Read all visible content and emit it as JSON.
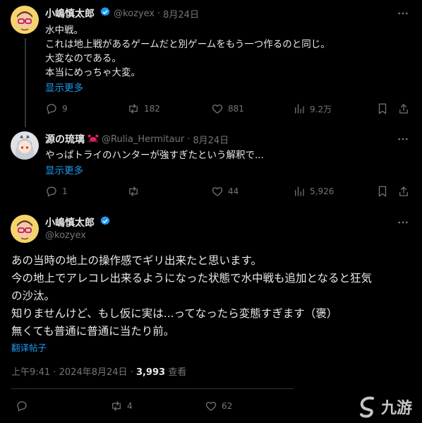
{
  "tweet1": {
    "author": "小嶋慎太郎",
    "handle": "@kozyex",
    "sep": "·",
    "date": "8月24日",
    "lines": [
      "水中戦。",
      "これは地上戦があるゲームだと別ゲームをもう一つ作るのと同じ。",
      "大変なのである。",
      "本当にめっちゃ大変。"
    ],
    "show_more": "显示更多",
    "replies": "9",
    "retweets": "182",
    "likes": "881",
    "views": "9.2万"
  },
  "tweet2": {
    "author": "源の琉璃",
    "handle": "@Rulia_Hermitaur",
    "sep": "·",
    "date": "8月24日",
    "lines": [
      "やっぱトライのハンターが強すぎたという解釈で..."
    ],
    "show_more": "显示更多",
    "replies": "1",
    "likes": "44",
    "views": "5,926"
  },
  "main_tweet": {
    "author": "小嶋慎太郎",
    "handle": "@kozyex",
    "lines": [
      "あの当時の地上の操作感でギリ出来たと思います。",
      "今の地上でアレコレ出来るようになった状態で水中戦も追加となると狂気",
      "の沙汰。",
      "知りませんけど、もし仮に実は...ってなったら変態すぎます（褒）",
      "無くても普通に普通に当たり前。"
    ],
    "translate": "翻译帖子",
    "time": "上午9:41",
    "date": "2024年8月24日",
    "view_count": "3,993",
    "view_label": "查看",
    "retweets": "4",
    "likes": "62"
  },
  "watermark": {
    "text": "九游"
  },
  "colors": {
    "accent": "#1d9bf0",
    "muted": "#71767b",
    "border": "#2f3336"
  }
}
